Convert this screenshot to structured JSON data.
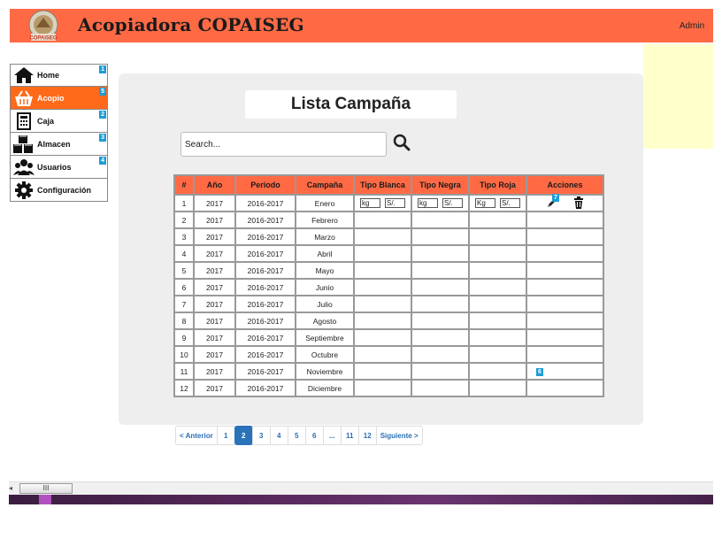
{
  "header": {
    "logo_text": "COPAISEG",
    "title": "Acopiadora COPAISEG",
    "user": "Admin",
    "accent_color": "#ff6a45"
  },
  "sidebar": {
    "items": [
      {
        "label": "Home",
        "icon": "home-icon",
        "badge": "1"
      },
      {
        "label": "Acopio",
        "icon": "basket-icon",
        "badge": "5",
        "active": true
      },
      {
        "label": "Caja",
        "icon": "calculator-icon",
        "badge": "2"
      },
      {
        "label": "Almacen",
        "icon": "boxes-icon",
        "badge": "3"
      },
      {
        "label": "Usuarios",
        "icon": "users-icon",
        "badge": "4"
      },
      {
        "label": "Configuración",
        "icon": "gear-icon",
        "badge": ""
      }
    ]
  },
  "main": {
    "title": "Lista Campaña",
    "search": {
      "placeholder": "Search...",
      "value": "Search..."
    },
    "table": {
      "headers": [
        "#",
        "Año",
        "Periodo",
        "Campaña",
        "Tipo Blanca",
        "Tipo Negra",
        "Tipo Roja",
        "Acciones"
      ],
      "rows": [
        {
          "n": "1",
          "anio": "2017",
          "periodo": "2016-2017",
          "campania": "Enero"
        },
        {
          "n": "2",
          "anio": "2017",
          "periodo": "2016-2017",
          "campania": "Febrero"
        },
        {
          "n": "3",
          "anio": "2017",
          "periodo": "2016-2017",
          "campania": "Marzo"
        },
        {
          "n": "4",
          "anio": "2017",
          "periodo": "2016-2017",
          "campania": "Abril"
        },
        {
          "n": "5",
          "anio": "2017",
          "periodo": "2016-2017",
          "campania": "Mayo"
        },
        {
          "n": "6",
          "anio": "2017",
          "periodo": "2016-2017",
          "campania": "Junio"
        },
        {
          "n": "7",
          "anio": "2017",
          "periodo": "2016-2017",
          "campania": "Julio"
        },
        {
          "n": "8",
          "anio": "2017",
          "periodo": "2016-2017",
          "campania": "Agosto"
        },
        {
          "n": "9",
          "anio": "2017",
          "periodo": "2016-2017",
          "campania": "Septiembre"
        },
        {
          "n": "10",
          "anio": "2017",
          "periodo": "2016-2017",
          "campania": "Octubre"
        },
        {
          "n": "11",
          "anio": "2017",
          "periodo": "2016-2017",
          "campania": "Noviembre"
        },
        {
          "n": "12",
          "anio": "2017",
          "periodo": "2016-2017",
          "campania": "Diciembre"
        }
      ],
      "row1_inputs": {
        "blanca": {
          "kg": "kg",
          "sl": "S/."
        },
        "negra": {
          "kg": "kg",
          "sl": "S/."
        },
        "roja": {
          "kg": "Kg",
          "sl": "S/."
        }
      },
      "actions_badge": "7",
      "row11_badge": "6"
    },
    "pagination": {
      "prev": "< Anterior",
      "pages": [
        "1",
        "2",
        "3",
        "4",
        "5",
        "6",
        "...",
        "11",
        "12"
      ],
      "active": "2",
      "next": "Siguiente >"
    }
  },
  "scrollbar": {
    "thumb_label": "III"
  }
}
